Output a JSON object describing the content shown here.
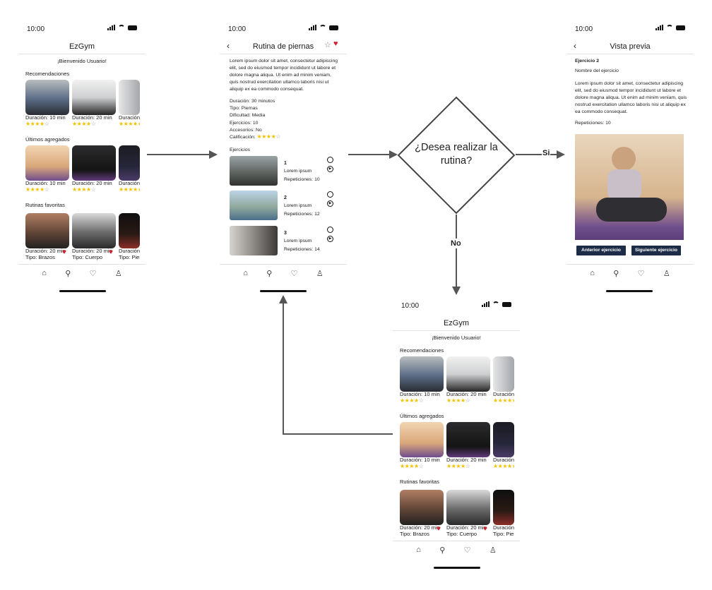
{
  "status": {
    "time": "10:00"
  },
  "home": {
    "title": "EzGym",
    "welcome": "¡Bienvenido Usuario!",
    "sections": [
      {
        "label": "Recomendaciones",
        "cards": [
          {
            "line1": "Duración: 10 min",
            "line2": "",
            "stars": 4
          },
          {
            "line1": "Duración: 20 min",
            "line2": "",
            "stars": 4
          },
          {
            "line1": "Duración:",
            "line2": "",
            "stars": 5
          }
        ]
      },
      {
        "label": "Últimos agregados",
        "cards": [
          {
            "line1": "Duración: 10 min",
            "line2": "",
            "stars": 4
          },
          {
            "line1": "Duración: 20 min",
            "line2": "",
            "stars": 4
          },
          {
            "line1": "Duración:",
            "line2": "",
            "stars": 5
          }
        ]
      },
      {
        "label": "Rutinas favoritas",
        "cards": [
          {
            "line1": "Duración: 20 min",
            "line2": "Tipo: Brazos",
            "stars": 0
          },
          {
            "line1": "Duración: 20 min",
            "line2": "Tipo: Cuerpo",
            "stars": 0
          },
          {
            "line1": "Duración:",
            "line2": "Tipo: Pier",
            "stars": 0
          }
        ]
      }
    ]
  },
  "routine": {
    "title": "Rutina de piernas",
    "description": "Lorem ipsum dolor sit amet, consectetur adipiscing elit, sed do eiusmod tempor incididunt ut labore et dolore magna aliqua. Ut enim ad minim veniam, quis nostrud exercitation ullamco laboris nisi ut aliquip ex ea commodo consequat.",
    "details": [
      "Duración: 30 minutos",
      "Tipo: Piernas",
      "Dificultad: Media",
      "Ejercicios: 10",
      "Accesorios: No"
    ],
    "rating_label": "Calificación:",
    "rating": 4,
    "exercises_label": "Ejercicios",
    "exercises": [
      {
        "num": "1",
        "name": "Lorem ipsum",
        "reps": "Repeticiones: 10"
      },
      {
        "num": "2",
        "name": "Lorem ipsum",
        "reps": "Repeticiones: 12"
      },
      {
        "num": "3",
        "name": "Lorem ipsum",
        "reps": "Repeticiones: 14"
      }
    ]
  },
  "decision": {
    "question": "¿Desea realizar la rutina?",
    "yes": "Si",
    "no": "No"
  },
  "preview": {
    "title": "Vista previa",
    "exercise_title": "Ejercicio 2",
    "exercise_name": "Nombre del ejercicio",
    "description": "Lorem ipsum dolor sit amet, consectetur adipiscing elit, sed do eiusmod tempor incididunt ut labore et dolore magna aliqua. Ut enim ad minim veniam, quis nostrud exercitation ullamco laboris nisi ut aliquip ex ea commodo consequat.",
    "reps": "Repeticiones: 10",
    "prev_button": "Anterior ejercicio",
    "next_button": "Siguiente ejercicio"
  },
  "colors": {
    "star": "#f2c200",
    "heart": "#d21f2b",
    "button": "#1c2c46",
    "arrow": "#555555"
  },
  "icons": {
    "nav": [
      "home-icon",
      "search-icon",
      "heart-icon",
      "user-icon"
    ]
  }
}
